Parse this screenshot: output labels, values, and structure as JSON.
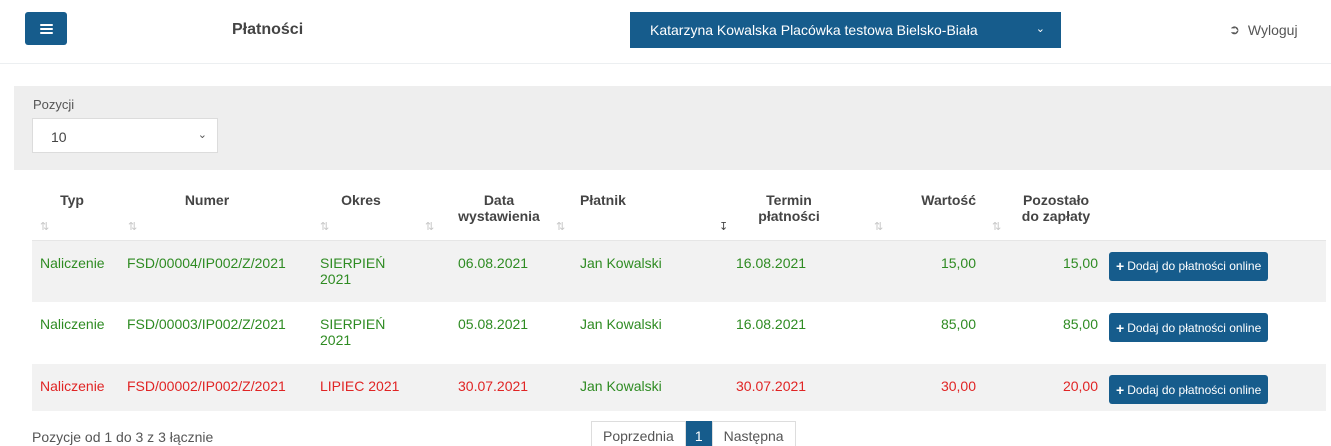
{
  "header": {
    "title": "Płatności",
    "location": "Katarzyna Kowalska Placówka testowa Bielsko-Biała",
    "logout": "Wyloguj"
  },
  "filter": {
    "label": "Pozycji",
    "page_size": "10"
  },
  "table": {
    "columns": [
      "Typ",
      "Numer",
      "Okres",
      "Data wystawienia",
      "Płatnik",
      "Termin płatności",
      "Wartość",
      "Pozostało do zapłaty"
    ],
    "action_label": "Dodaj do płatności online",
    "rows": [
      {
        "type": "Naliczenie",
        "number": "FSD/00004/IP002/Z/2021",
        "period": "SIERPIEŃ 2021",
        "issued": "06.08.2021",
        "payer": "Jan Kowalski",
        "due": "16.08.2021",
        "value": "15,00",
        "remaining": "15,00",
        "status": "green"
      },
      {
        "type": "Naliczenie",
        "number": "FSD/00003/IP002/Z/2021",
        "period": "SIERPIEŃ 2021",
        "issued": "05.08.2021",
        "payer": "Jan Kowalski",
        "due": "16.08.2021",
        "value": "85,00",
        "remaining": "85,00",
        "status": "green"
      },
      {
        "type": "Naliczenie",
        "number": "FSD/00002/IP002/Z/2021",
        "period": "LIPIEC 2021",
        "issued": "30.07.2021",
        "payer": "Jan Kowalski",
        "due": "30.07.2021",
        "value": "30,00",
        "remaining": "20,00",
        "status": "red"
      }
    ]
  },
  "footer": {
    "info": "Pozycje od 1 do 3 z 3 łącznie",
    "prev": "Poprzednia",
    "page": "1",
    "next": "Następna"
  },
  "colors": {
    "primary": "#165c8c",
    "ok_text": "#2e8b22",
    "overdue_text": "#e02424",
    "stripe": "#f2f2f2"
  }
}
